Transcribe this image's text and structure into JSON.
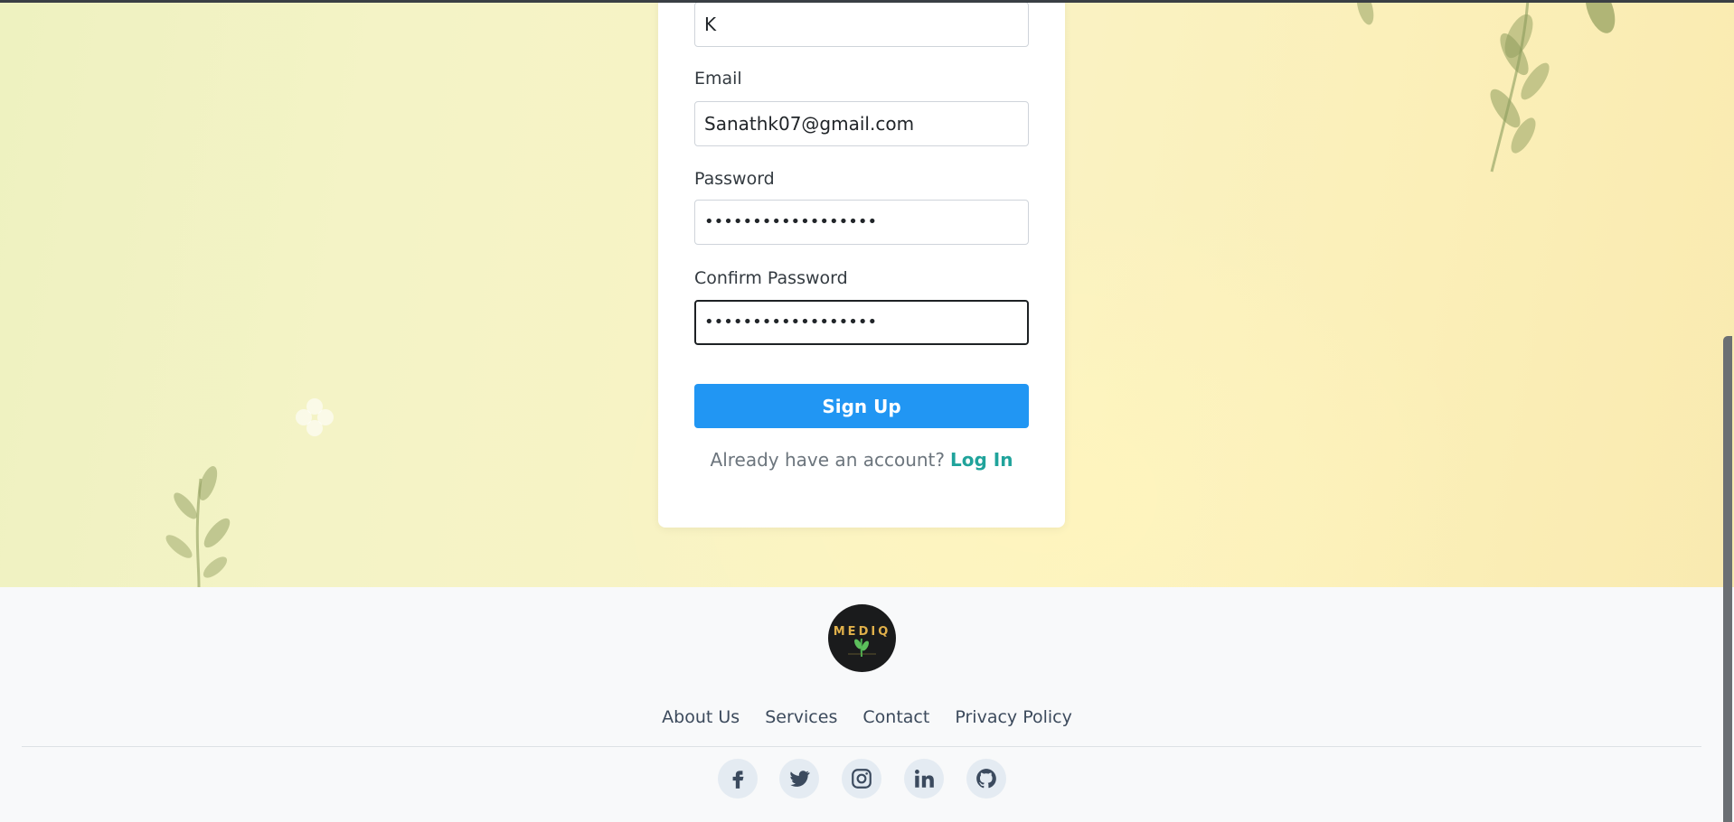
{
  "form": {
    "name_value": "K",
    "email_label": "Email",
    "email_value": "Sanathk07@gmail.com",
    "password_label": "Password",
    "password_value": "••••••••••••••••••",
    "confirm_label": "Confirm Password",
    "confirm_value": "••••••••••••••••••",
    "signup_label": "Sign Up",
    "already_text": "Already have an account?",
    "login_label": "Log In"
  },
  "footer": {
    "logo_text": "MEDIQ",
    "links": [
      "About Us",
      "Services",
      "Contact",
      "Privacy Policy"
    ],
    "social_icons": [
      "facebook-icon",
      "twitter-icon",
      "instagram-icon",
      "linkedin-icon",
      "github-icon"
    ]
  },
  "colors": {
    "primary_button": "#2196f3",
    "link_accent": "#20a39b",
    "footer_bg": "#f8f9fa"
  }
}
